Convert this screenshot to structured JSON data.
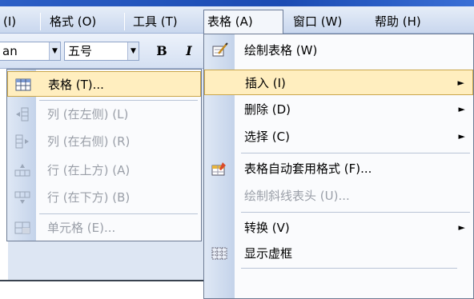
{
  "menubar": {
    "items": [
      {
        "label": "(I)"
      },
      {
        "label": "格式 (O)"
      },
      {
        "label": "工具 (T)"
      },
      {
        "label": "表格 (A)"
      },
      {
        "label": "窗口 (W)"
      },
      {
        "label": "帮助 (H)"
      }
    ]
  },
  "toolbar": {
    "font_name": "an",
    "font_size": "五号",
    "bold": "B",
    "italic": "I"
  },
  "table_menu": {
    "items": [
      {
        "label": "绘制表格 (W)",
        "icon": "pencil-icon"
      },
      {
        "label": "插入 (I)",
        "arrow": "►"
      },
      {
        "label": "删除 (D)",
        "arrow": "►"
      },
      {
        "label": "选择 (C)",
        "arrow": "►"
      },
      {
        "label": "表格自动套用格式 (F)...",
        "icon": "autoformat-icon"
      },
      {
        "label": "绘制斜线表头 (U)..."
      },
      {
        "label": "转换 (V)",
        "arrow": "►"
      },
      {
        "label": "显示虚框",
        "icon": "gridlines-icon"
      }
    ]
  },
  "insert_menu": {
    "items": [
      {
        "label": "表格 (T)...",
        "icon": "table-icon"
      },
      {
        "label": "列 (在左侧) (L)",
        "icon": "column-left-icon"
      },
      {
        "label": "列 (在右侧) (R)",
        "icon": "column-right-icon"
      },
      {
        "label": "行 (在上方) (A)",
        "icon": "row-above-icon"
      },
      {
        "label": "行 (在下方) (B)",
        "icon": "row-below-icon"
      },
      {
        "label": "单元格 (E)...",
        "icon": "cell-icon"
      }
    ]
  },
  "colors": {
    "highlight": "#ffeebf",
    "highlight_border": "#caa64a",
    "disabled_text": "#9a9fa8"
  }
}
